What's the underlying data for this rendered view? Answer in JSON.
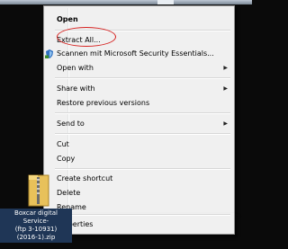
{
  "menu": {
    "open": "Open",
    "extract_all": "Extract All...",
    "scan": "Scannen mit Microsoft Security Essentials...",
    "open_with": "Open with",
    "share_with": "Share with",
    "restore": "Restore previous versions",
    "send_to": "Send to",
    "cut": "Cut",
    "copy": "Copy",
    "create_shortcut": "Create shortcut",
    "delete": "Delete",
    "rename": "Rename",
    "properties": "Properties",
    "submenu_arrow": "▶"
  },
  "file": {
    "line1": "Boxcar digital",
    "line2": "Service-",
    "line3": "(ftp 3-10931)",
    "line4": "(2016-1).zip"
  },
  "colors": {
    "highlight_ellipse": "#d6211f",
    "menu_background": "#f0f0f0"
  },
  "icons": {
    "scan": "microsoft-security-essentials-icon",
    "file": "zip-folder-icon"
  }
}
